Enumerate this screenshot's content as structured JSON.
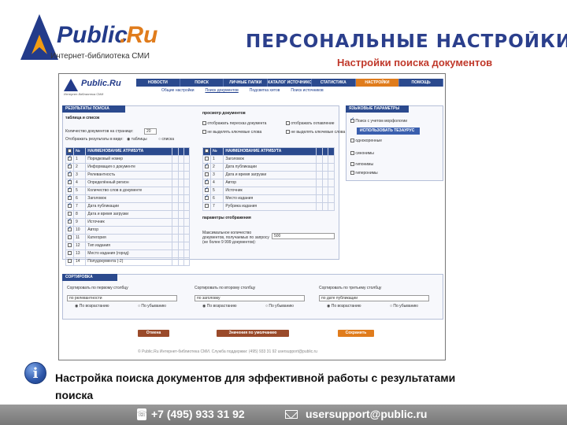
{
  "header": {
    "logo_text": "Public.Ru",
    "logo_subtitle": "Интернет-библиотека СМИ",
    "title": "ПЕРСОНАЛЬНЫЕ НАСТРОЙКИ",
    "subtitle": "Настройки поиска документов"
  },
  "screenshot": {
    "logo_text": "Public.Ru",
    "logo_subtitle": "Интернет-библиотека СМИ",
    "nav": [
      "НОВОСТИ",
      "ПОИСК",
      "ЛИЧНЫЕ ПАПКИ",
      "КАТАЛОГ ИСТОЧНИКОВ",
      "СТАТИСТИКА",
      "НАСТРОЙКИ",
      "ПОМОЩЬ"
    ],
    "nav_active_index": 5,
    "subnav": [
      "Общие настройки",
      "Поиск документов",
      "Подсветка хитов",
      "Поиск источников"
    ],
    "results_panel_title": "РЕЗУЛЬТАТЫ ПОИСКА",
    "table_list_heading": "таблица и список",
    "docs_count_label": "Количество документов на странице:",
    "docs_count_value": "20",
    "show_results_label": "Отображать результаты в виде:",
    "view_table": "таблицы",
    "view_list": "списка",
    "col_num": "№",
    "col_attr_name": "НАИМЕНОВАНИЕ АТРИБУТА",
    "left_rows": [
      {
        "num": "1",
        "name": "Порядковый номер",
        "on": true
      },
      {
        "num": "2",
        "name": "Информация о документе",
        "on": true
      },
      {
        "num": "3",
        "name": "Релевантность",
        "on": true
      },
      {
        "num": "4",
        "name": "Определённый регион",
        "on": true
      },
      {
        "num": "5",
        "name": "Количество слов в документе",
        "on": true
      },
      {
        "num": "6",
        "name": "Заголовок",
        "on": true
      },
      {
        "num": "7",
        "name": "Дата публикации",
        "on": true
      },
      {
        "num": "8",
        "name": "Дата и время загрузки",
        "on": false
      },
      {
        "num": "9",
        "name": "Источник",
        "on": true
      },
      {
        "num": "10",
        "name": "Автор",
        "on": true
      },
      {
        "num": "11",
        "name": "Категория",
        "on": false
      },
      {
        "num": "12",
        "name": "Тип издания",
        "on": false
      },
      {
        "num": "13",
        "name": "Место издания (город)",
        "on": false
      },
      {
        "num": "14",
        "name": "Полудокумента (-2)",
        "on": false
      }
    ],
    "view_heading": "просмотр документов",
    "view_opt1": "отображать пересказ документа",
    "view_opt2": "не выделять ключевые слова",
    "view_opt3": "отображать оглавление",
    "view_opt4": "не выделять ключевые слова",
    "right_rows": [
      {
        "num": "1",
        "name": "Заголовок",
        "on": false
      },
      {
        "num": "2",
        "name": "Дата публикации",
        "on": true
      },
      {
        "num": "3",
        "name": "Дата и время загрузки",
        "on": false
      },
      {
        "num": "4",
        "name": "Автор",
        "on": true
      },
      {
        "num": "5",
        "name": "Источник",
        "on": true
      },
      {
        "num": "6",
        "name": "Место издания",
        "on": true
      },
      {
        "num": "7",
        "name": "Рубрика издания",
        "on": false
      }
    ],
    "display_params_heading": "параметры отображения",
    "max_docs_label": "Максимальное количество документов, получаемых по запросу (не более 9 999 документов):",
    "max_docs_value": "500",
    "lang_panel_title": "ЯЗЫКОВЫЕ ПАРАМЕТРЫ",
    "morph_label": "Поиск с учетом морфологии",
    "thesaurus_title": "ИСПОЛЬЗОВАТЬ ТЕЗАУРУС",
    "thesaurus_items": [
      "однокоренные",
      "синонимы",
      "гипонимы",
      "гиперонимы"
    ],
    "sort_panel_title": "СОРТИРОВКА",
    "sort_cols": [
      {
        "title": "Сортировать по первому столбцу",
        "value": "по релевантности"
      },
      {
        "title": "Сортировать по второму столбцу",
        "value": "по заголовку"
      },
      {
        "title": "Сортировать по третьему столбцу",
        "value": "по дате публикации"
      }
    ],
    "sort_asc": "По возрастанию",
    "sort_desc": "По убыванию",
    "btn_back": "Отмена",
    "btn_defaults": "Значения по умолчанию",
    "btn_save": "Сохранить",
    "footer_text": "© Public.Ru Интернет-библиотека СМИ. Служба поддержки: (495) 933 31 92 usersupport@public.ru"
  },
  "caption": "Настройка поиска документов для эффективной работы с результатами поиска",
  "contacts": {
    "phone": "+7 (495) 933 31 92",
    "email": "usersupport@public.ru"
  }
}
